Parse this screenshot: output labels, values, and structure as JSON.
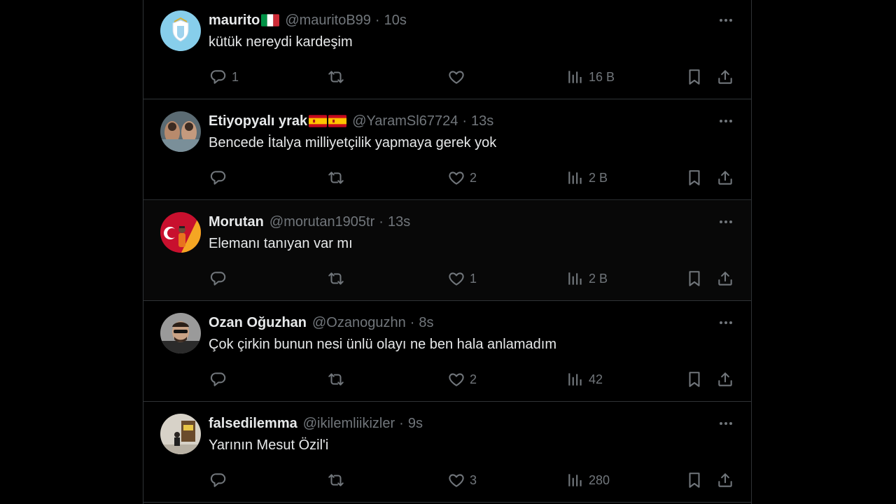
{
  "colors": {
    "background": "#000000",
    "border": "#2f3336",
    "text_primary": "#e7e9ea",
    "text_secondary": "#71767b",
    "hover_row": "#080808"
  },
  "tweets": [
    {
      "name": "maurito",
      "flags": [
        "italy-flag"
      ],
      "handle": "@mauritoB99",
      "separator": "·",
      "time": "10s",
      "text": "kütük nereydi kardeşim",
      "replies": "1",
      "retweets": "",
      "likes": "",
      "views": "16 B",
      "avatar": "lazio-crest-avatar",
      "hover": false
    },
    {
      "name": "Etiyopyalı yrak",
      "flags": [
        "spain-flag",
        "spain-flag"
      ],
      "handle": "@YaramSl67724",
      "separator": "·",
      "time": "13s",
      "text": "Bencede İtalya milliyetçilik yapmaya gerek yok",
      "replies": "",
      "retweets": "",
      "likes": "2",
      "views": "2 B",
      "avatar": "photo-avatar",
      "hover": false
    },
    {
      "name": "Morutan",
      "flags": [],
      "handle": "@morutan1905tr",
      "separator": "·",
      "time": "13s",
      "text": "Elemanı tanıyan var mı",
      "replies": "",
      "retweets": "",
      "likes": "1",
      "views": "2 B",
      "avatar": "galatasaray-avatar",
      "hover": true
    },
    {
      "name": "Ozan Oğuzhan",
      "flags": [],
      "handle": "@Ozanoguzhn",
      "separator": "·",
      "time": "8s",
      "text": "Çok çirkin bunun nesi ünlü olayı ne ben hala anlamadım",
      "replies": "",
      "retweets": "",
      "likes": "2",
      "views": "42",
      "avatar": "portrait-avatar",
      "hover": false
    },
    {
      "name": "falsedilemma",
      "flags": [],
      "handle": "@ikilemliikizler",
      "separator": "·",
      "time": "9s",
      "text": "Yarının Mesut Özil'i",
      "replies": "",
      "retweets": "",
      "likes": "3",
      "views": "280",
      "avatar": "street-photo-avatar",
      "hover": false
    }
  ],
  "icons": {
    "reply": "reply-icon",
    "retweet": "retweet-icon",
    "like": "heart-icon",
    "views": "views-chart-icon",
    "bookmark": "bookmark-icon",
    "share": "share-icon",
    "more": "more-dots-icon"
  }
}
